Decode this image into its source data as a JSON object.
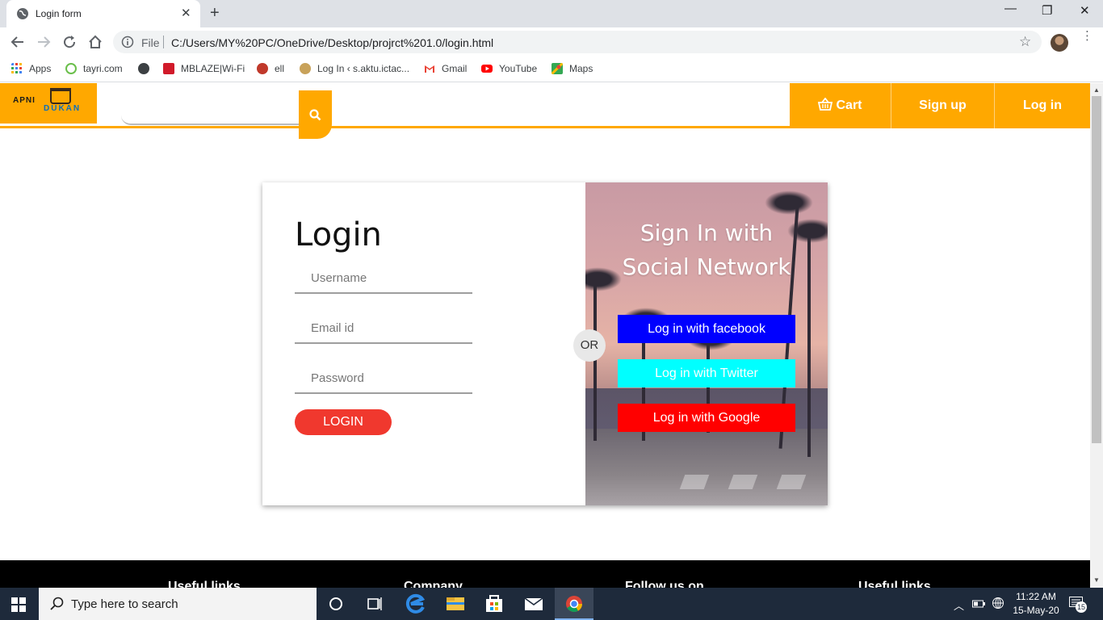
{
  "browser": {
    "tab_title": "Login form",
    "tab_close": "✕",
    "new_tab": "+",
    "window_controls": {
      "minimize": "—",
      "maximize": "❐",
      "close": "✕"
    },
    "omnibox": {
      "file_label": "File",
      "url": "C:/Users/MY%20PC/OneDrive/Desktop/projrct%201.0/login.html",
      "star": "☆"
    },
    "menu": "⋮",
    "bookmarks": [
      {
        "label": "Apps",
        "icon": "apps-grid-icon",
        "color": "#4285f4"
      },
      {
        "label": "tayri.com",
        "icon": "tayri-icon",
        "color": "#6abf4b"
      },
      {
        "label": "",
        "icon": "globe-icon",
        "color": "#3c4043"
      },
      {
        "label": "MBLAZE|Wi-Fi",
        "icon": "mblaze-icon",
        "color": "#d11a2a"
      },
      {
        "label": "ell",
        "icon": "ell-icon",
        "color": "#c0392b"
      },
      {
        "label": "Log In ‹ s.aktu.ictac...",
        "icon": "aktu-icon",
        "color": "#c8a25a"
      },
      {
        "label": "Gmail",
        "icon": "gmail-icon",
        "color": "#ea4335"
      },
      {
        "label": "YouTube",
        "icon": "youtube-icon",
        "color": "#ff0000"
      },
      {
        "label": "Maps",
        "icon": "maps-icon",
        "color": "#34a853"
      }
    ]
  },
  "site": {
    "logo_top": "APNI",
    "logo_bottom": "DUKAN",
    "search_placeholder": "",
    "nav": {
      "cart": "Cart",
      "signup": "Sign up",
      "login": "Log in"
    },
    "accent_color": "#ffa800"
  },
  "login_form": {
    "title": "Login",
    "fields": {
      "username_placeholder": "Username",
      "email_placeholder": "Email id",
      "password_placeholder": "Password"
    },
    "submit": "LOGIN",
    "submit_color": "#f0382e",
    "or": "OR"
  },
  "social": {
    "title_line1": "Sign In with",
    "title_line2": "Social Network",
    "facebook": {
      "label": "Log in with facebook",
      "color": "#0000ff"
    },
    "twitter": {
      "label": "Log in with Twitter",
      "color": "#00ffff"
    },
    "google": {
      "label": "Log in with Google",
      "color": "#ff0000"
    }
  },
  "footer": {
    "headings": [
      "Useful links",
      "Company",
      "Follow us on",
      "Useful links"
    ]
  },
  "taskbar": {
    "search_text": "Type here to search",
    "time": "11:22 AM",
    "date": "15-May-20",
    "notification_count": "15"
  }
}
